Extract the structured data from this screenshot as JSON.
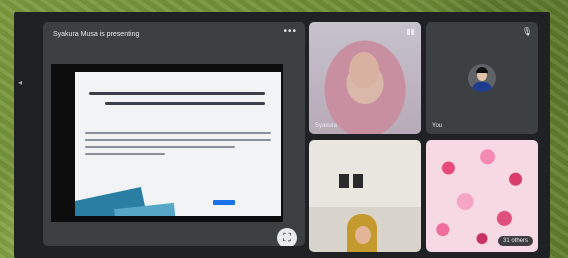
{
  "presentation": {
    "title": "Syakura Musa is presenting"
  },
  "participants": {
    "tile_a_name": "Syakura",
    "tile_b_name": "You",
    "others_label": "31 others"
  }
}
